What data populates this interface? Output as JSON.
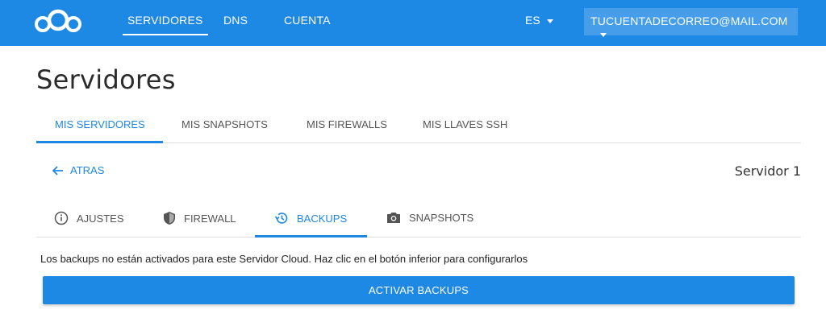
{
  "header": {
    "logo_icon": "cloud-circles-logo",
    "nav": [
      {
        "label": "SERVIDORES",
        "active": true
      },
      {
        "label": "DNS",
        "active": false
      },
      {
        "label": "CUENTA",
        "active": false
      }
    ],
    "language": "ES",
    "account_email": "TUCUENTADECORREO@MAIL.COM",
    "background_color": "#1e88e5"
  },
  "page": {
    "title": "Servidores"
  },
  "main_tabs": [
    {
      "label": "MIS SERVIDORES",
      "active": true
    },
    {
      "label": "MIS SNAPSHOTS",
      "active": false
    },
    {
      "label": "MIS FIREWALLS",
      "active": false
    },
    {
      "label": "MIS LLAVES SSH",
      "active": false
    }
  ],
  "back": {
    "icon": "arrow-left-icon",
    "label": "ATRAS"
  },
  "server_name": "Servidor 1",
  "sub_tabs": [
    {
      "label": "AJUSTES",
      "icon": "info-icon",
      "active": false
    },
    {
      "label": "FIREWALL",
      "icon": "shield-icon",
      "active": false
    },
    {
      "label": "BACKUPS",
      "icon": "history-icon",
      "active": true
    },
    {
      "label": "SNAPSHOTS",
      "icon": "camera-icon",
      "active": false
    }
  ],
  "backups": {
    "message": "Los backups no están activados para este Servidor Cloud. Haz clic en el botón inferior para configurarlos",
    "button_label": "ACTIVAR BACKUPS"
  },
  "accent_color": "#1e88e5"
}
